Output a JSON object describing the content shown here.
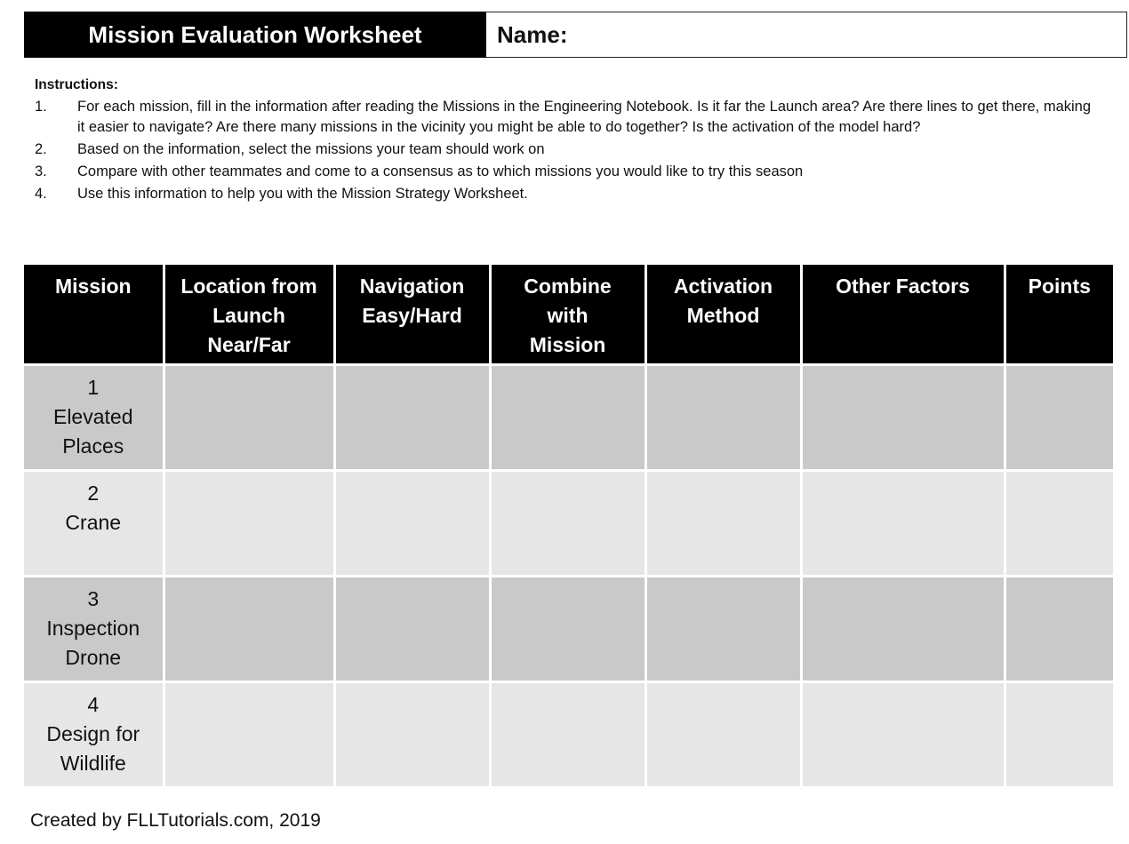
{
  "header": {
    "title": "Mission Evaluation Worksheet",
    "name_label": "Name:",
    "name_value": ""
  },
  "instructions": {
    "title": "Instructions:",
    "items": [
      {
        "num": "1.",
        "text": "For each mission, fill in the information after reading the Missions in the Engineering Notebook. Is it far the Launch area? Are there lines to get there, making it easier to navigate? Are there many missions in the vicinity you might be able to do together? Is the activation of the model hard?"
      },
      {
        "num": "2.",
        "text": "Based on the information, select the missions your team should work on"
      },
      {
        "num": "3.",
        "text": "Compare with other teammates and come to a consensus as to which missions you would like to try this season"
      },
      {
        "num": "4.",
        "text": "Use this information to help you with the Mission Strategy Worksheet."
      }
    ]
  },
  "table": {
    "columns": [
      {
        "lines": [
          "Mission"
        ]
      },
      {
        "lines": [
          "Location from",
          "Launch",
          "Near/Far"
        ]
      },
      {
        "lines": [
          "Navigation",
          "Easy/Hard"
        ]
      },
      {
        "lines": [
          "Combine",
          "with",
          "Mission"
        ]
      },
      {
        "lines": [
          "Activation",
          "Method"
        ]
      },
      {
        "lines": [
          "Other Factors"
        ]
      },
      {
        "lines": [
          "Points"
        ]
      }
    ],
    "rows": [
      {
        "number": "1",
        "name_lines": [
          "Elevated",
          "Places"
        ],
        "cells": [
          "",
          "",
          "",
          "",
          "",
          ""
        ]
      },
      {
        "number": "2",
        "name_lines": [
          "Crane"
        ],
        "cells": [
          "",
          "",
          "",
          "",
          "",
          ""
        ]
      },
      {
        "number": "3",
        "name_lines": [
          "Inspection",
          "Drone"
        ],
        "cells": [
          "",
          "",
          "",
          "",
          "",
          ""
        ]
      },
      {
        "number": "4",
        "name_lines": [
          "Design for",
          "Wildlife"
        ],
        "cells": [
          "",
          "",
          "",
          "",
          "",
          ""
        ]
      }
    ]
  },
  "footer": {
    "credit": "Created by FLLTutorials.com, 2019"
  }
}
